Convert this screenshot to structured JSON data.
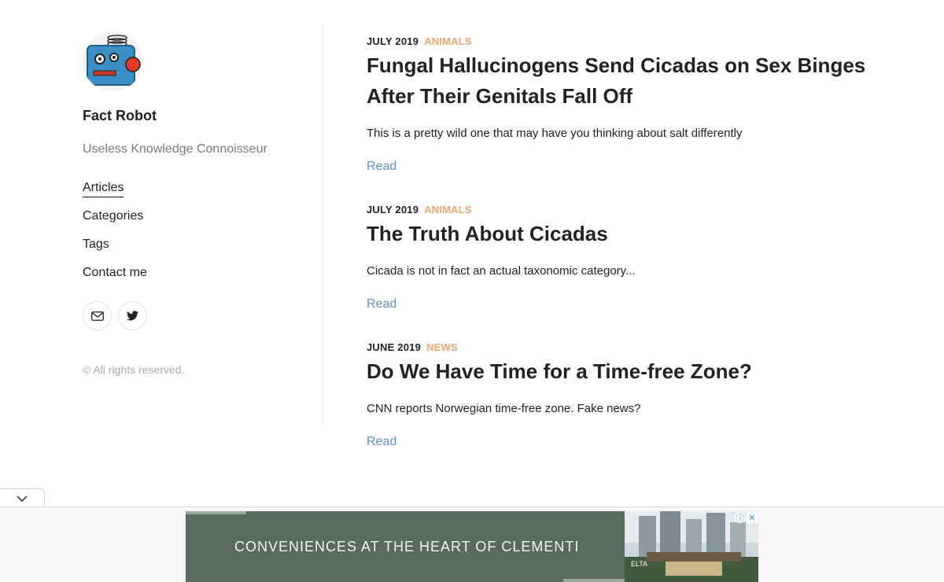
{
  "sidebar": {
    "title": "Fact Robot",
    "subtitle": "Useless Knowledge Connoisseur",
    "nav": [
      {
        "label": "Articles",
        "active": true
      },
      {
        "label": "Categories"
      },
      {
        "label": "Tags"
      },
      {
        "label": "Contact me"
      }
    ],
    "social_icons": [
      "mail-icon",
      "twitter-icon"
    ],
    "copyright": "© All rights reserved."
  },
  "posts": [
    {
      "date": "JULY 2019",
      "category": "ANIMALS",
      "title": "Fungal Hallucinogens Send Cicadas on Sex Binges After Their Genitals Fall Off",
      "excerpt": "This is a pretty wild one that may have you thinking about salt differently",
      "read_label": "Read"
    },
    {
      "date": "JULY 2019",
      "category": "ANIMALS",
      "title": "The Truth About Cicadas",
      "excerpt": "Cicada is not in fact an actual taxonomic category...",
      "read_label": "Read"
    },
    {
      "date": "JUNE 2019",
      "category": "NEWS",
      "title": "Do We Have Time for a Time-free Zone?",
      "excerpt": "CNN reports Norwegian time-free zone. Fake news?",
      "read_label": "Read"
    }
  ],
  "ad": {
    "text": "CONVENIENCES AT THE HEART OF CLEMENTI",
    "image_caption": "ELTA",
    "info_icon": "info-icon",
    "close_icon": "close-icon"
  },
  "colors": {
    "category": "#f0a46b",
    "link": "#5b8fd6",
    "ad_background": "#5a6a5c"
  }
}
